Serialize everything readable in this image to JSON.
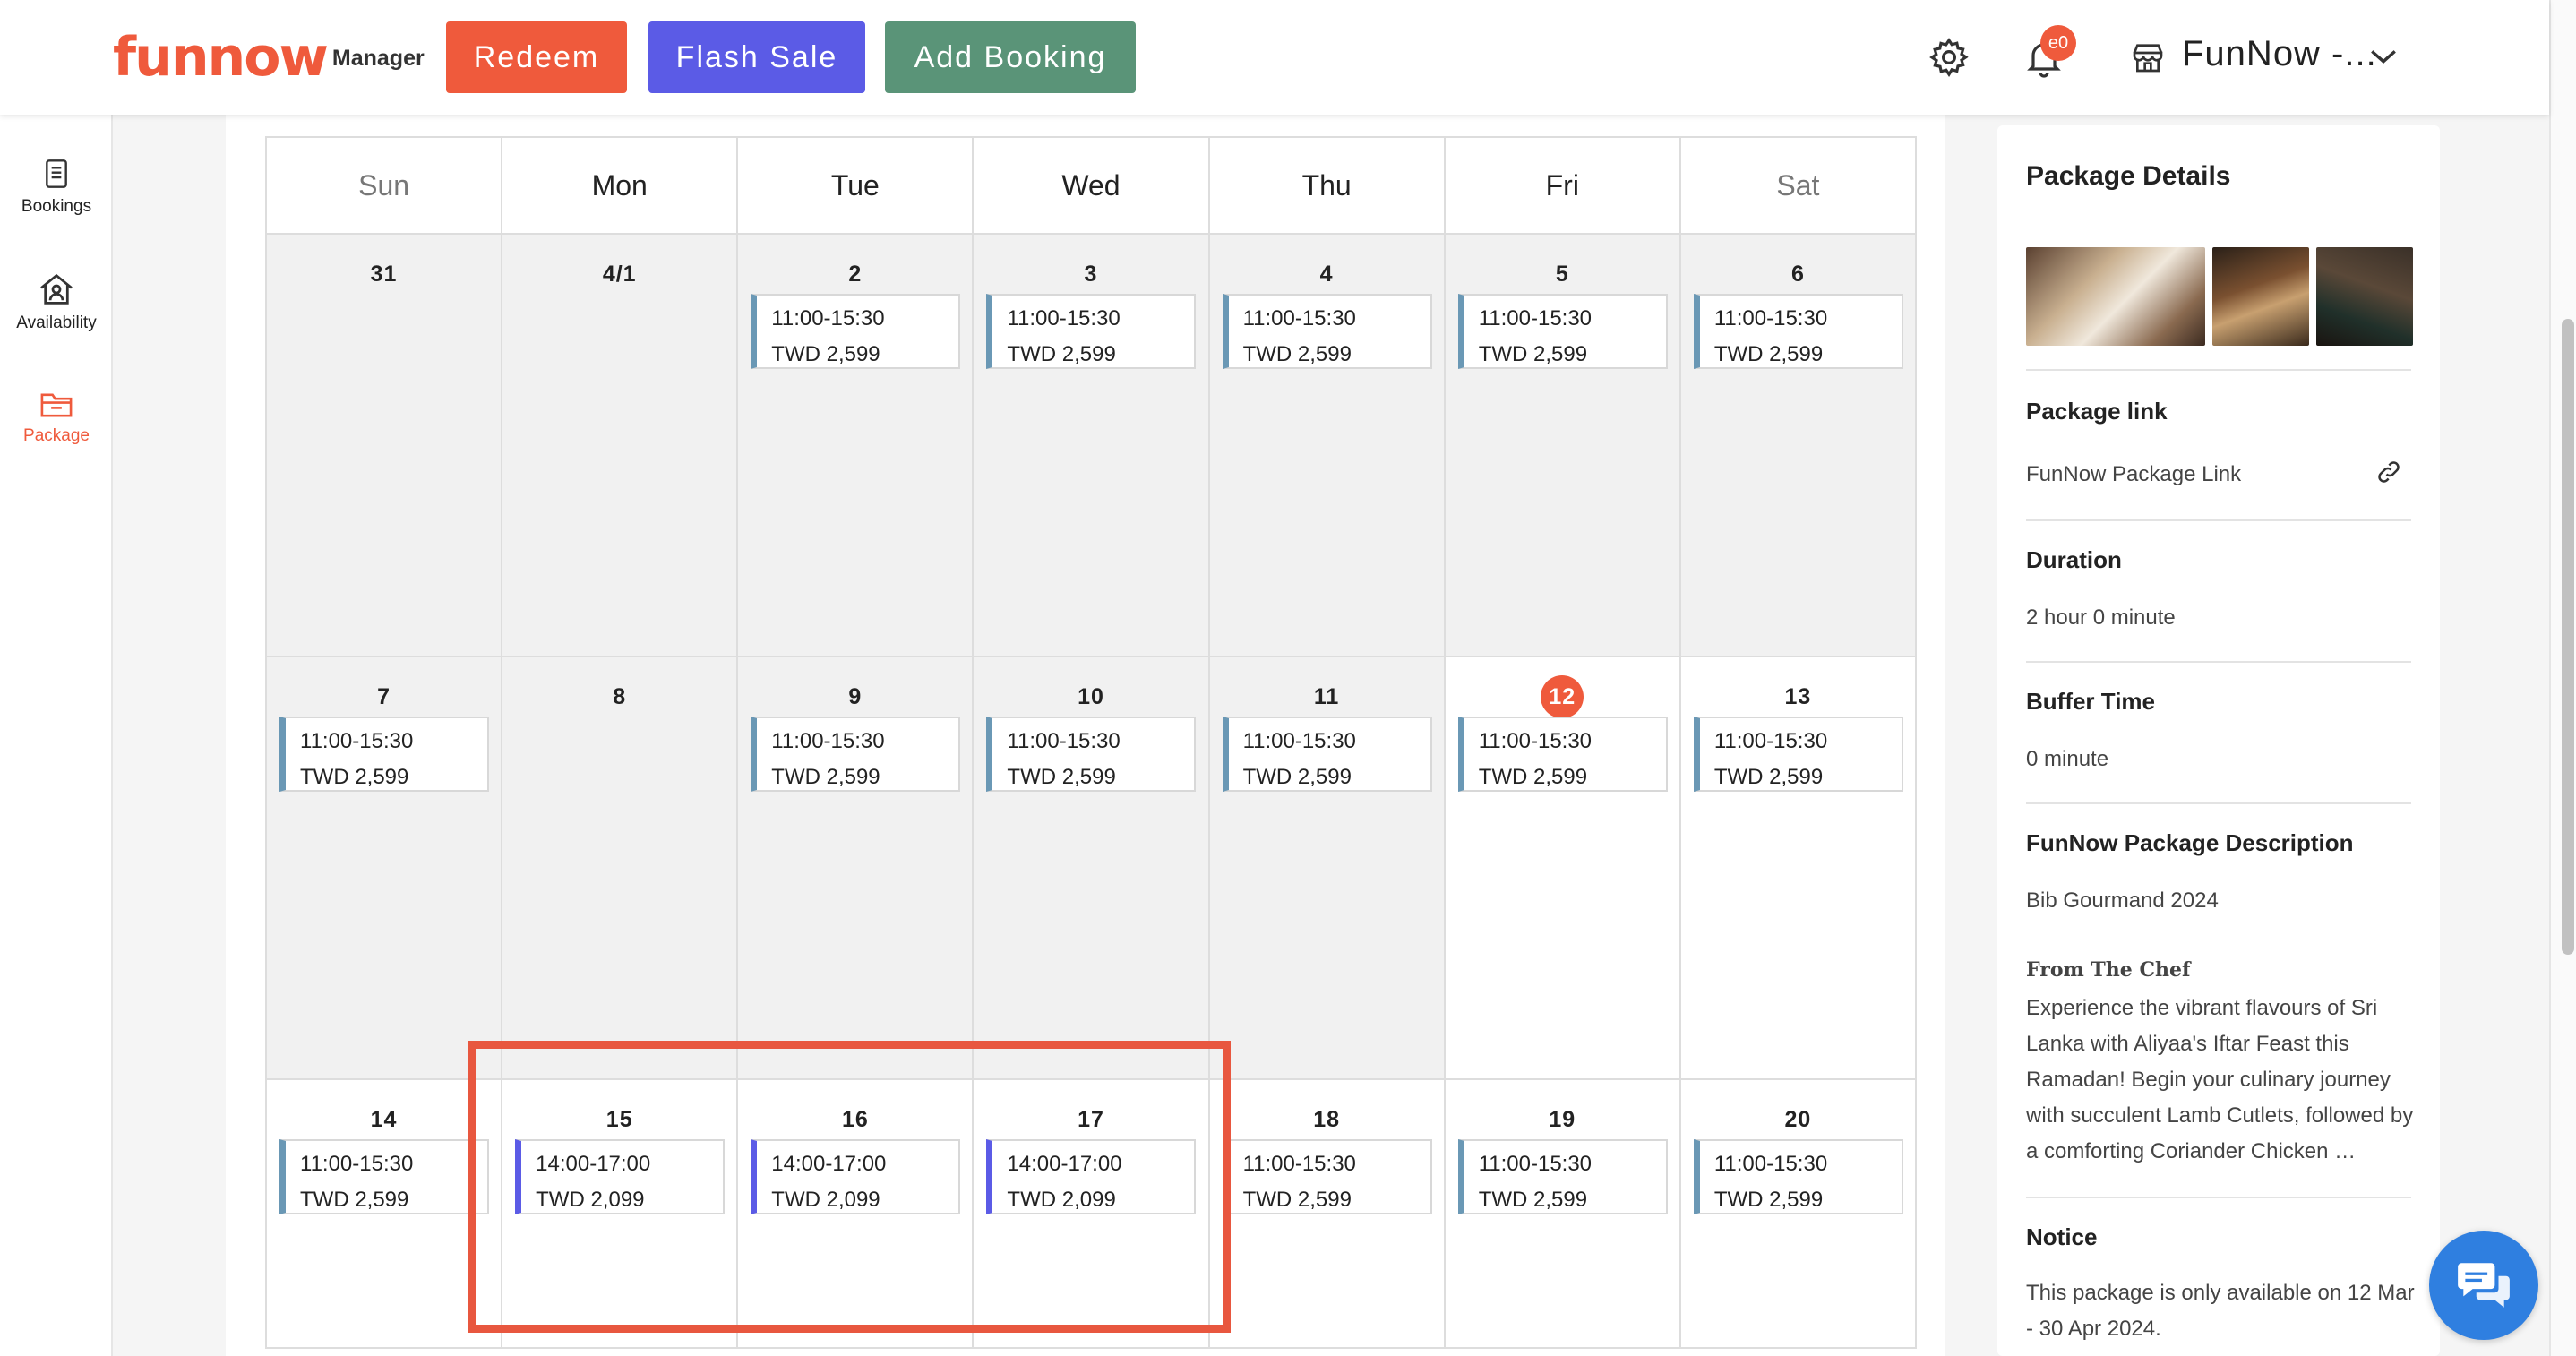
{
  "header": {
    "logo_text": "funnow",
    "logo_sub": "Manager",
    "redeem_label": "Redeem",
    "flash_sale_label": "Flash Sale",
    "add_booking_label": "Add Booking",
    "notification_count": "e0",
    "store_name": "FunNow -..."
  },
  "sidebar": {
    "items": [
      {
        "label": "Bookings",
        "icon": "bookings-icon"
      },
      {
        "label": "Availability",
        "icon": "availability-icon"
      },
      {
        "label": "Package",
        "icon": "package-icon",
        "active": true
      }
    ]
  },
  "calendar": {
    "weekdays": [
      "Sun",
      "Mon",
      "Tue",
      "Wed",
      "Thu",
      "Fri",
      "Sat"
    ],
    "weeks": [
      [
        {
          "day": "31",
          "past": true
        },
        {
          "day": "4/1",
          "past": true
        },
        {
          "day": "2",
          "past": true,
          "time": "11:00-15:30",
          "price": "TWD 2,599"
        },
        {
          "day": "3",
          "past": true,
          "time": "11:00-15:30",
          "price": "TWD 2,599"
        },
        {
          "day": "4",
          "past": true,
          "time": "11:00-15:30",
          "price": "TWD 2,599"
        },
        {
          "day": "5",
          "past": true,
          "time": "11:00-15:30",
          "price": "TWD 2,599"
        },
        {
          "day": "6",
          "past": true,
          "time": "11:00-15:30",
          "price": "TWD 2,599"
        }
      ],
      [
        {
          "day": "7",
          "past": true,
          "time": "11:00-15:30",
          "price": "TWD 2,599"
        },
        {
          "day": "8",
          "past": true
        },
        {
          "day": "9",
          "past": true,
          "time": "11:00-15:30",
          "price": "TWD 2,599"
        },
        {
          "day": "10",
          "past": true,
          "time": "11:00-15:30",
          "price": "TWD 2,599"
        },
        {
          "day": "11",
          "past": true,
          "time": "11:00-15:30",
          "price": "TWD 2,599"
        },
        {
          "day": "12",
          "today": true,
          "time": "11:00-15:30",
          "price": "TWD 2,599"
        },
        {
          "day": "13",
          "time": "11:00-15:30",
          "price": "TWD 2,599"
        }
      ],
      [
        {
          "day": "14",
          "time": "11:00-15:30",
          "price": "TWD 2,599"
        },
        {
          "day": "15",
          "flash": true,
          "time": "14:00-17:00",
          "price": "TWD 2,099"
        },
        {
          "day": "16",
          "flash": true,
          "time": "14:00-17:00",
          "price": "TWD 2,099"
        },
        {
          "day": "17",
          "flash": true,
          "time": "14:00-17:00",
          "price": "TWD 2,099"
        },
        {
          "day": "18",
          "time": "11:00-15:30",
          "price": "TWD 2,599"
        },
        {
          "day": "19",
          "time": "11:00-15:30",
          "price": "TWD 2,599"
        },
        {
          "day": "20",
          "time": "11:00-15:30",
          "price": "TWD 2,599"
        }
      ]
    ]
  },
  "panel": {
    "title": "Package Details",
    "link_label": "Package link",
    "link_text": "FunNow Package Link",
    "duration_label": "Duration",
    "duration_value": "2 hour 0 minute",
    "buffer_label": "Buffer Time",
    "buffer_value": "0 minute",
    "desc_label": "FunNow Package Description",
    "desc_value": "Bib Gourmand 2024",
    "chef_heading": "From The Chef",
    "chef_text": "Experience the vibrant flavours of Sri Lanka with Aliyaa's Iftar Feast this Ramadan! Begin your culinary journey with succulent Lamb Cutlets, followed by a comforting Coriander Chicken …",
    "notice_label": "Notice",
    "notice_value": "This package is only available on 12 Mar - 30 Apr 2024."
  },
  "colors": {
    "brand": "#ef5a3c",
    "flash": "#5b5be6",
    "add_booking": "#5a9478",
    "slot_regular": "#6a98b5"
  }
}
